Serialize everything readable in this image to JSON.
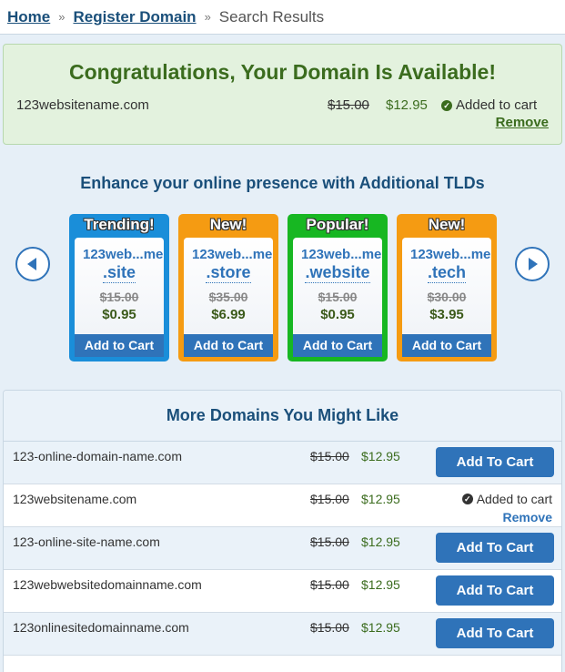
{
  "breadcrumb": {
    "home": "Home",
    "register": "Register Domain",
    "current": "Search Results",
    "separator": "»"
  },
  "banner": {
    "title": "Congratulations, Your Domain Is Available!",
    "domain": "123websitename.com",
    "old_price": "$15.00",
    "new_price": "$12.95",
    "status": "Added to cart",
    "remove": "Remove"
  },
  "tlds": {
    "heading": "Enhance your online presence with Additional TLDs",
    "cards": [
      {
        "badge": "Trending!",
        "name": "123web...me",
        "ext": ".site",
        "old_price": "$15.00",
        "new_price": "$0.95",
        "cta": "Add to Cart",
        "color": "#1a8ed9"
      },
      {
        "badge": "New!",
        "name": "123web...me",
        "ext": ".store",
        "old_price": "$35.00",
        "new_price": "$6.99",
        "cta": "Add to Cart",
        "color": "#f59b12"
      },
      {
        "badge": "Popular!",
        "name": "123web...me",
        "ext": ".website",
        "old_price": "$15.00",
        "new_price": "$0.95",
        "cta": "Add to Cart",
        "color": "#17b722"
      },
      {
        "badge": "New!",
        "name": "123web...me",
        "ext": ".tech",
        "old_price": "$30.00",
        "new_price": "$3.95",
        "cta": "Add to Cart",
        "color": "#f59b12"
      }
    ]
  },
  "more": {
    "title": "More Domains You Might Like",
    "rows": [
      {
        "name": "123-online-domain-name.com",
        "old_price": "$15.00",
        "new_price": "$12.95",
        "button": "Add To Cart"
      },
      {
        "name": "123websitename.com",
        "old_price": "$15.00",
        "new_price": "$12.95",
        "status": "Added to cart",
        "remove": "Remove"
      },
      {
        "name": "123-online-site-name.com",
        "old_price": "$15.00",
        "new_price": "$12.95",
        "button": "Add To Cart"
      },
      {
        "name": "123webwebsitedomainname.com",
        "old_price": "$15.00",
        "new_price": "$12.95",
        "button": "Add To Cart"
      },
      {
        "name": "123onlinesitedomainname.com",
        "old_price": "$15.00",
        "new_price": "$12.95",
        "button": "Add To Cart"
      }
    ]
  },
  "colors": {
    "link_blue": "#2f73b9",
    "heading_blue": "#1a4f7a",
    "success_green": "#3b6c1e",
    "banner_bg": "#e3f2de"
  },
  "icons": {
    "prev": "chevron-left-icon",
    "next": "chevron-right-icon",
    "check": "check-circle-icon"
  }
}
